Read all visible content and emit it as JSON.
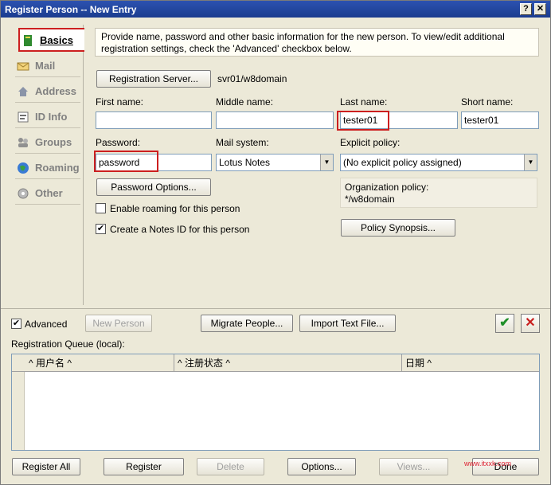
{
  "window": {
    "title": "Register Person -- New Entry",
    "help_glyph": "?",
    "close_glyph": "✕"
  },
  "sidebar": {
    "items": [
      {
        "label": "Basics",
        "icon": "basics-icon"
      },
      {
        "label": "Mail",
        "icon": "mail-icon"
      },
      {
        "label": "Address",
        "icon": "address-icon"
      },
      {
        "label": "ID Info",
        "icon": "id-info-icon"
      },
      {
        "label": "Groups",
        "icon": "groups-icon"
      },
      {
        "label": "Roaming",
        "icon": "roaming-icon"
      },
      {
        "label": "Other",
        "icon": "other-icon"
      }
    ]
  },
  "info": {
    "text": "Provide name, password and other basic information for the new person.  To view/edit additional registration settings, check the 'Advanced' checkbox below."
  },
  "registration_server": {
    "button": "Registration Server...",
    "value": "svr01/w8domain"
  },
  "name_fields": {
    "first_label": "First name:",
    "first_value": "",
    "middle_label": "Middle name:",
    "middle_value": "",
    "last_label": "Last name:",
    "last_value": "tester01",
    "short_label": "Short name:",
    "short_value": "tester01"
  },
  "password": {
    "label": "Password:",
    "value": "password",
    "options_button": "Password Options..."
  },
  "mail_system": {
    "label": "Mail system:",
    "value": "Lotus Notes"
  },
  "explicit_policy": {
    "label": "Explicit policy:",
    "value": "(No explicit policy assigned)"
  },
  "org_policy": {
    "label": "Organization policy:",
    "value": "*/w8domain"
  },
  "policy_synopsis_button": "Policy Synopsis...",
  "options": {
    "roaming_label": "Enable roaming for this person",
    "roaming_checked": false,
    "notes_id_label": "Create a Notes ID for this person",
    "notes_id_checked": true
  },
  "bottom_bar": {
    "advanced_label": "Advanced",
    "advanced_checked": true,
    "new_person": "New Person",
    "migrate": "Migrate People...",
    "import_text": "Import Text File..."
  },
  "queue": {
    "label": "Registration Queue (local):",
    "columns": [
      "用户名",
      "注册状态",
      "日期"
    ]
  },
  "footer": {
    "register_all": "Register All",
    "register": "Register",
    "delete": "Delete",
    "options": "Options...",
    "views": "Views...",
    "done": "Done"
  },
  "watermark": "www.itxxk.com",
  "colors": {
    "highlight": "#cc1f1f",
    "titlebar": "#1b3c8f",
    "ok_green": "#1f8f2a",
    "cancel_red": "#c81e1e"
  }
}
